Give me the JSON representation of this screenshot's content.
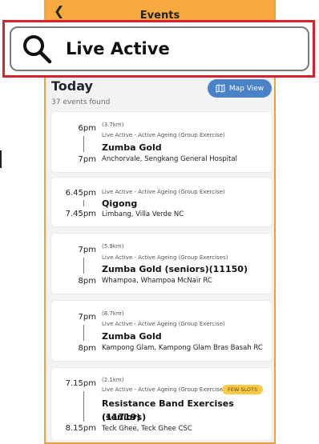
{
  "header": {
    "title": "Events",
    "back_icon": "back-chevron-icon"
  },
  "search": {
    "query": "Live Active",
    "icon": "search-icon"
  },
  "section": {
    "title": "Today",
    "count_text": "37 events found",
    "map_button_label": "Map View"
  },
  "events": [
    {
      "start": "6pm",
      "end": "7pm",
      "distance": "(3.7km)",
      "category": "Live Active - Active Ageing (Group Exercise)",
      "name": "Zumba Gold",
      "location": "Anchorvale, Sengkang General Hospital"
    },
    {
      "start": "6.45pm",
      "end": "7.45pm",
      "distance": "",
      "category": "Live Active - Active Ageing (Group Exercise)",
      "name": "Qigong",
      "location": "Limbang, Villa Verde NC"
    },
    {
      "start": "7pm",
      "end": "8pm",
      "distance": "(5.9km)",
      "category": "Live Active - Active Ageing (Group Exercises)",
      "name": "Zumba Gold (seniors)(11150)",
      "location": "Whampoa, Whampoa McNair RC"
    },
    {
      "start": "7pm",
      "end": "8pm",
      "distance": "(8.7km)",
      "category": "Live Active - Active Ageing (Group Exercise)",
      "name": "Zumba Gold",
      "location": "Kampong Glam, Kampong Glam Bras Basah RC"
    },
    {
      "start": "7.15pm",
      "end": "8.15pm",
      "distance": "(2.1km)",
      "category": "Live Active - Active Ageing (Group Exercises)",
      "badge": "FEW SLOTS",
      "name": "Resistance Band Exercises (seniors)",
      "name_line2": "(11719)",
      "location": "Teck Ghee, Teck Ghee CSC"
    }
  ],
  "colors": {
    "accent": "#f6a93e",
    "highlight": "#d6232d",
    "button": "#4a82c8",
    "badge": "#f7c948"
  }
}
